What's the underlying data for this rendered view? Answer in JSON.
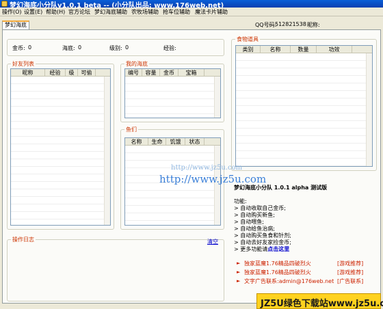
{
  "window": {
    "title": "梦幻海底小分队v1.0.1 beta -- (小分队出品: www.176web.net)"
  },
  "menu": [
    {
      "label": "操作(O)"
    },
    {
      "label": "设置(E)"
    },
    {
      "label": "帮助(H)"
    },
    {
      "label": "官方论坛"
    },
    {
      "label": "梦幻海底辅助"
    },
    {
      "label": "农牧场辅助"
    },
    {
      "label": "抢车位辅助"
    },
    {
      "label": "魔法卡片辅助"
    }
  ],
  "tabs": [
    {
      "label": "梦幻海底"
    }
  ],
  "account": {
    "qq_label": "QQ号码:",
    "qq_value": "512821538",
    "nick_label": "昵称:"
  },
  "stats": {
    "gold_label": "金币:",
    "gold_value": "0",
    "coral_label": "海底:",
    "coral_value": "0",
    "level_label": "级别:",
    "level_value": "0",
    "exp_label": "经验:"
  },
  "friends": {
    "title": "好友列表",
    "columns": [
      "昵称",
      "经验",
      "级",
      "可偷"
    ]
  },
  "my_sea": {
    "title": "我的海底",
    "columns": [
      "编号",
      "容量",
      "金币",
      "宝箱"
    ]
  },
  "fish": {
    "title": "鱼们",
    "columns": [
      "名称",
      "生命",
      "饥饿",
      "状态"
    ]
  },
  "food": {
    "title": "食物道具",
    "columns": [
      "类别",
      "名称",
      "数量",
      "功效"
    ]
  },
  "log": {
    "title": "操作日志",
    "clear_label": "清空"
  },
  "notice": {
    "title": "梦幻海底小分队  1.0.1 alpha 测试版",
    "func_label": "功能:",
    "lines": [
      "> 自动收取自己金币;",
      "> 自动购买新鱼;",
      "> 自动喂鱼;",
      "> 自动给鱼治病;",
      "> 自动购买鱼食和针剂;",
      "> 自动去好友家捡金币;"
    ],
    "more_prefix": "> 更多功能请",
    "more_link": "点击这里"
  },
  "ads": [
    {
      "text": "独家蓝魔1.76精品四破烈火",
      "tag": "[游戏推荐]"
    },
    {
      "text": "独家蓝魔1.76精品四破烈火",
      "tag": "[游戏推荐]"
    },
    {
      "text": "文字广告联系:admin@176web.net",
      "tag": "[广告联系]"
    }
  ],
  "watermarks": {
    "small": "http://www.jz5u.com",
    "big": "http://www.jz5u.com"
  },
  "brand_banner": "JZ5U绿色下载站www.jz5u.com",
  "colors": {
    "accent": "#cc3300",
    "title_bar": "#0a4fc4",
    "link": "#0000cc",
    "banner": "#ffd21f"
  }
}
